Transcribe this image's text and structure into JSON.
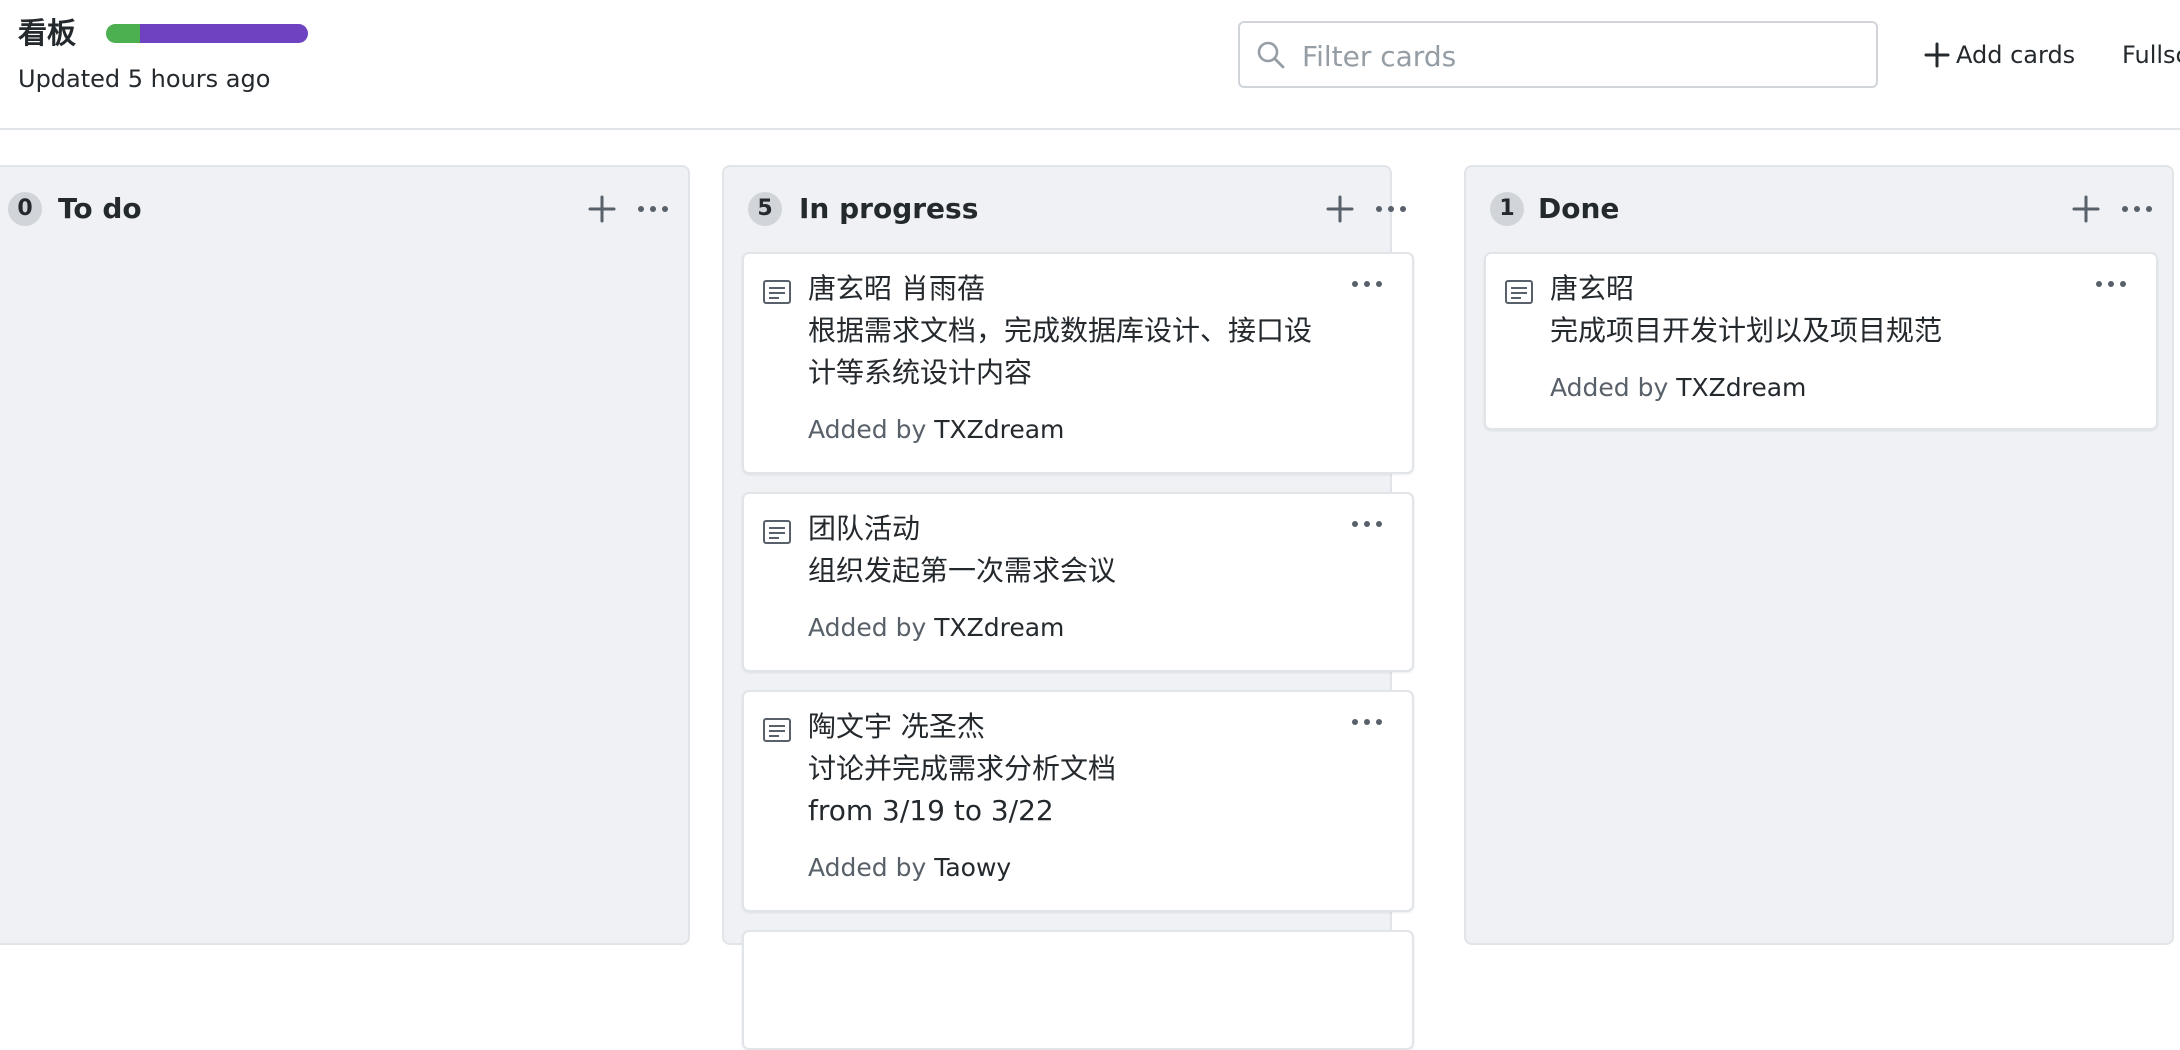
{
  "header": {
    "title": "看板",
    "updated": "Updated 5 hours ago",
    "progress": {
      "segments": [
        {
          "fraction": 0.1667,
          "color": "#4caf50"
        },
        {
          "fraction": 0.8333,
          "color": "#6f42c1"
        }
      ]
    },
    "filter": {
      "placeholder": "Filter cards",
      "value": ""
    },
    "add_cards_label": "Add cards",
    "fullscreen_label": "Fullscreen"
  },
  "columns": [
    {
      "id": "todo",
      "count": "0",
      "name": "To do",
      "cards": []
    },
    {
      "id": "progress",
      "count": "5",
      "name": "In progress",
      "cards": [
        {
          "lines": [
            "唐玄昭 肖雨蓓",
            "根据需求文档，完成数据库设计、接口设",
            "计等系统设计内容"
          ],
          "added_prefix": "Added by",
          "author": "TXZdream"
        },
        {
          "lines": [
            "团队活动",
            "组织发起第一次需求会议"
          ],
          "added_prefix": "Added by",
          "author": "TXZdream"
        },
        {
          "lines": [
            "陶文宇 冼圣杰",
            "讨论并完成需求分析文档",
            "from 3/19 to 3/22"
          ],
          "added_prefix": "Added by",
          "author": "Taowy"
        }
      ]
    },
    {
      "id": "done",
      "count": "1",
      "name": "Done",
      "cards": [
        {
          "lines": [
            "唐玄昭",
            "完成项目开发计划以及项目规范"
          ],
          "added_prefix": "Added by",
          "author": "TXZdream"
        }
      ]
    }
  ],
  "icons": {
    "search": "search-icon",
    "plus": "plus-icon",
    "fullscreen": "fullscreen-icon",
    "column_menu": "kebab-horizontal-icon",
    "note": "note-icon"
  }
}
